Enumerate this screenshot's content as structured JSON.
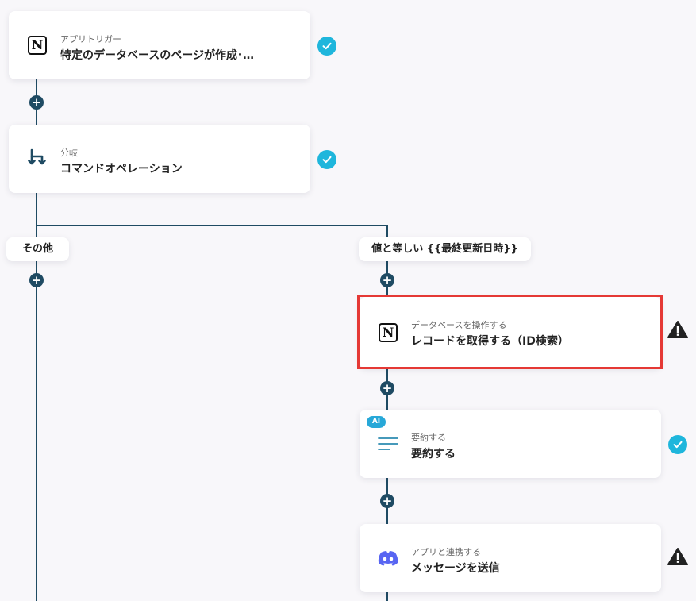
{
  "nodes": {
    "trigger": {
      "subtitle": "アプリトリガー",
      "title": "特定のデータベースのページが作成･…",
      "icon": "notion-icon",
      "status": "completed"
    },
    "branch": {
      "subtitle": "分岐",
      "title": "コマンドオペレーション",
      "icon": "branch-icon",
      "status": "completed"
    },
    "get_record": {
      "subtitle": "データベースを操作する",
      "title": "レコードを取得する（ID検索）",
      "icon": "notion-icon",
      "status": "warning",
      "highlighted": true
    },
    "summarize": {
      "subtitle": "要約する",
      "title": "要約する",
      "icon": "summary-lines-icon",
      "badge": "AI",
      "status": "completed"
    },
    "discord": {
      "subtitle": "アプリと連携する",
      "title": "メッセージを送信",
      "icon": "discord-icon",
      "status": "warning"
    }
  },
  "branches": {
    "left": {
      "label": "その他"
    },
    "right": {
      "label": "値と等しい {{最終更新日時}}"
    }
  },
  "colors": {
    "connector": "#1f4b63",
    "check": "#1fb6dc",
    "highlight": "#e53935",
    "ai_badge": "#27a8d8",
    "discord": "#5865f2"
  }
}
